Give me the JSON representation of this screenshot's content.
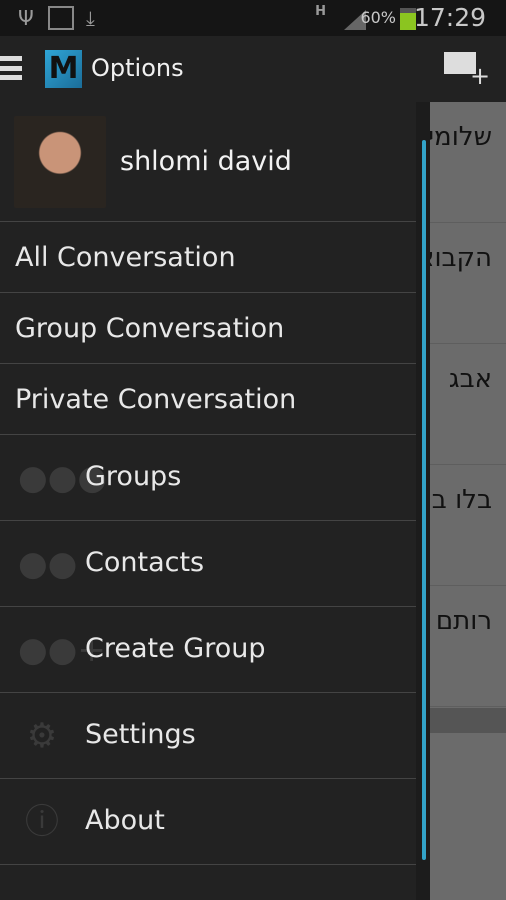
{
  "status_bar": {
    "battery": "60%",
    "time": "17:29",
    "network": "H",
    "icons": [
      "usb-icon",
      "image-icon",
      "download-icon",
      "signal-icon",
      "battery-charging-icon"
    ]
  },
  "app_bar": {
    "title": "Options",
    "compose_icon": "mail-plus-icon"
  },
  "drawer": {
    "user_name": "shlomi david",
    "text_items": [
      {
        "label": "All Conversation"
      },
      {
        "label": "Group Conversation"
      },
      {
        "label": "Private Conversation"
      }
    ],
    "icon_items": [
      {
        "label": "Groups",
        "icon": "groups-icon"
      },
      {
        "label": "Contacts",
        "icon": "contacts-icon"
      },
      {
        "label": "Create Group",
        "icon": "create-group-icon"
      },
      {
        "label": "Settings",
        "icon": "gear-icon"
      },
      {
        "label": "About",
        "icon": "info-icon"
      }
    ]
  },
  "background_list": [
    "שלומי",
    "הקבוצה",
    "אבג",
    "בלו בלו",
    "רותם"
  ],
  "colors": {
    "accent": "#33a3c8",
    "battery": "#8bc520"
  }
}
